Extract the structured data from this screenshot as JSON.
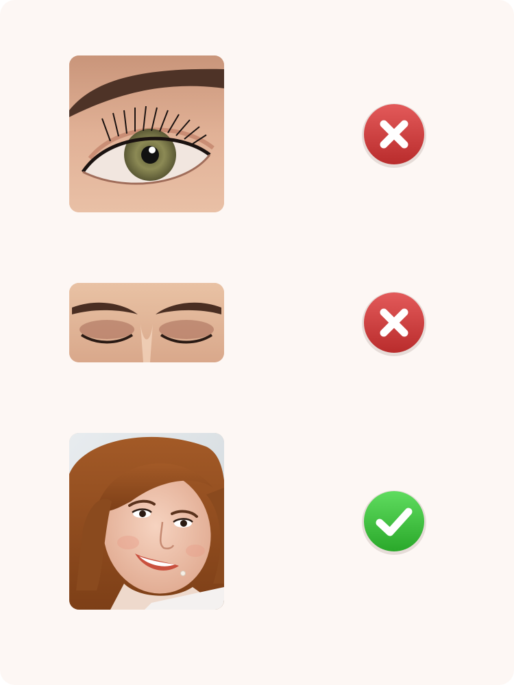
{
  "examples": [
    {
      "subject": "eye-closeup-photo",
      "verdict": "rejected",
      "verdict_icon": "cross-icon",
      "verdict_color": "#d23f3f"
    },
    {
      "subject": "closed-eyes-photo",
      "verdict": "rejected",
      "verdict_icon": "cross-icon",
      "verdict_color": "#d23f3f"
    },
    {
      "subject": "face-portrait-photo",
      "verdict": "accepted",
      "verdict_icon": "check-icon",
      "verdict_color": "#3cc43c"
    }
  ],
  "colors": {
    "background": "#fdf7f4",
    "reject_top": "#e35a5a",
    "reject_bottom": "#b92c2c",
    "accept_top": "#5fdc5f",
    "accept_bottom": "#2aa82a"
  }
}
